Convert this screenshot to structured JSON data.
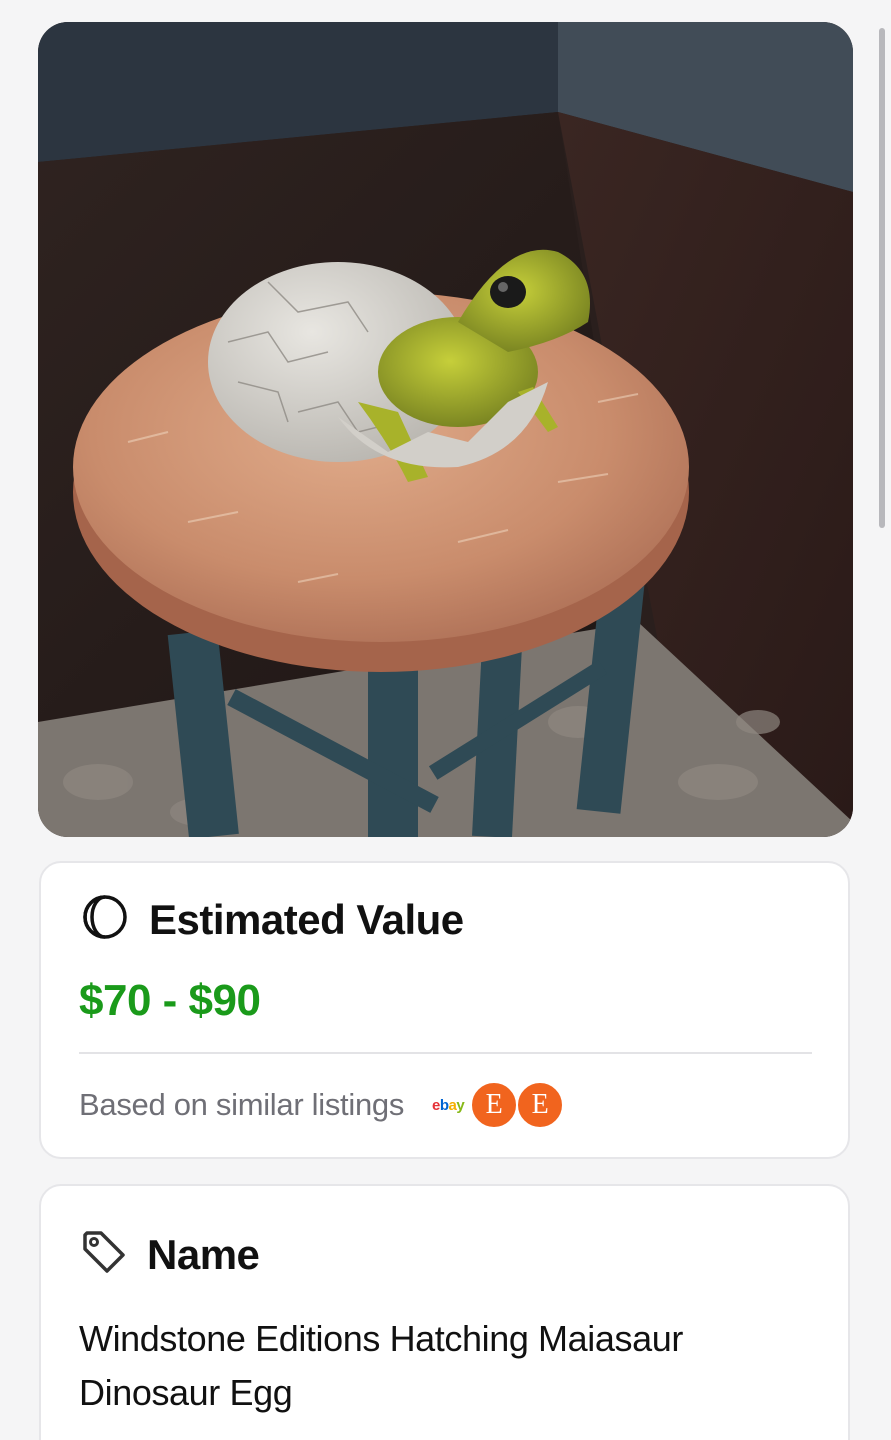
{
  "photo": {
    "alt_icon": "hatching-dinosaur-egg-photo"
  },
  "estimated_value": {
    "icon": "value-circle-icon",
    "title": "Estimated Value",
    "price_range": "$70 - $90",
    "price_color": "#1a9a1a",
    "source_text": "Based on similar listings",
    "sources": {
      "ebay_label": "ebay",
      "etsy_label_1": "E",
      "etsy_label_2": "E"
    }
  },
  "name_card": {
    "icon": "tag-icon",
    "title": "Name",
    "value": "Windstone Editions Hatching Maiasaur Dinosaur Egg"
  }
}
